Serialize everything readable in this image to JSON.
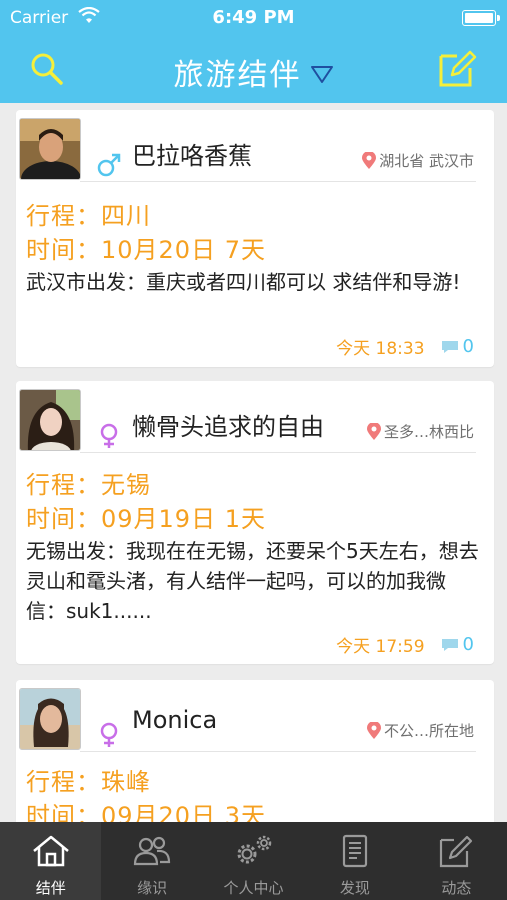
{
  "status_bar": {
    "carrier": "Carrier",
    "time": "6:49 PM"
  },
  "nav": {
    "title": "旅游结伴"
  },
  "posts": [
    {
      "username": "巴拉咯香蕉",
      "gender": "male",
      "location": "湖北省 武汉市",
      "route": "行程：四川",
      "date": "时间：10月20日 7天",
      "description": "武汉市出发：重庆或者四川都可以 求结伴和导游!",
      "time": "今天  18:33",
      "comments": "0"
    },
    {
      "username": "懒骨头追求的自由",
      "gender": "female",
      "location": "圣多…林西比",
      "route": "行程：无锡",
      "date": "时间：09月19日 1天",
      "description": "无锡出发：我现在在无锡，还要呆个5天左右，想去灵山和鼋头渚，有人结伴一起吗，可以的加我微信：suk1......",
      "time": "今天  17:59",
      "comments": "0"
    },
    {
      "username": "Monica",
      "gender": "female",
      "location": "不公…所在地",
      "route": "行程：珠峰",
      "date": "时间：09月20日 3天"
    }
  ],
  "tabs": [
    {
      "label": "结伴",
      "icon": "home-icon",
      "active": true
    },
    {
      "label": "缘识",
      "icon": "people-icon",
      "active": false
    },
    {
      "label": "个人中心",
      "icon": "gears-icon",
      "active": false
    },
    {
      "label": "发现",
      "icon": "document-icon",
      "active": false
    },
    {
      "label": "动态",
      "icon": "edit-icon",
      "active": false
    }
  ],
  "colors": {
    "nav_bg": "#52c5ee",
    "accent_yellow": "#f5ef3a",
    "trip_orange": "#f5a020",
    "male_blue": "#52c5ee",
    "female_purple": "#c86ee8",
    "pin_red": "#f07a7a",
    "tabbar_bg": "#2e2e2e"
  }
}
